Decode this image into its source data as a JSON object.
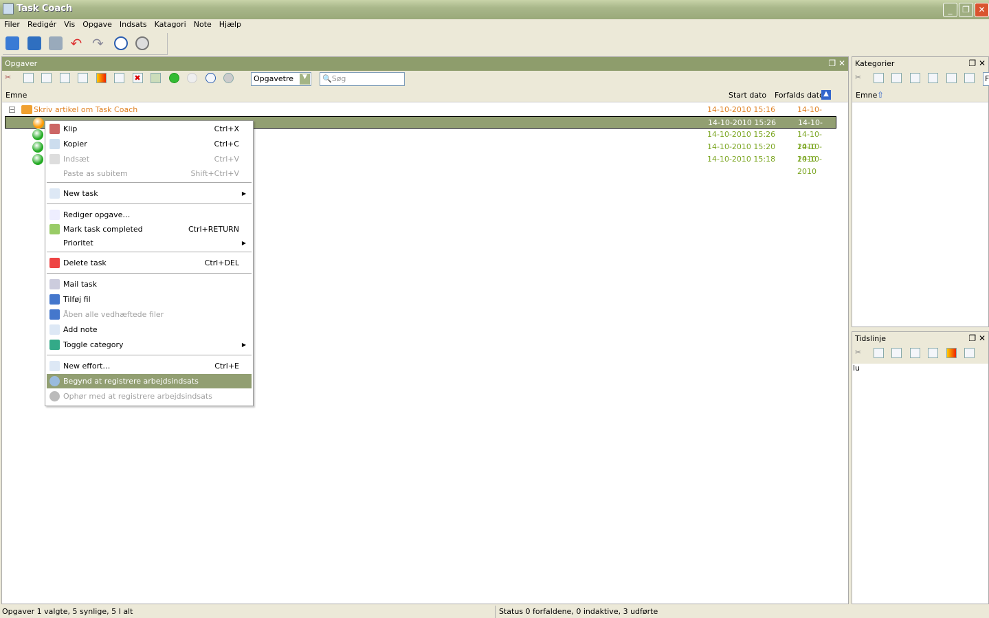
{
  "window": {
    "title": "Task Coach",
    "controls": [
      "minimize",
      "restore",
      "close"
    ]
  },
  "menubar": [
    "Filer",
    "Redigér",
    "Vis",
    "Opgave",
    "Indsats",
    "Katagori",
    "Note",
    "Hjælp"
  ],
  "main_toolbar": [
    "open-icon",
    "save-icon",
    "print-icon",
    "undo-icon",
    "redo-icon",
    "start-tracking-icon",
    "stop-tracking-icon"
  ],
  "tasks_panel": {
    "title": "Opgaver",
    "view_select": "Opgavetre",
    "search_placeholder": "Søg",
    "columns": {
      "subject": "Emne",
      "start": "Start dato",
      "due": "Forfalds dato"
    },
    "rows": [
      {
        "subject": "Skriv artikel om Task Coach",
        "start": "14-10-2010 15:16",
        "due": "14-10-2010",
        "status": "active",
        "color": "#e08020"
      },
      {
        "subject": "",
        "start": "14-10-2010 15:26",
        "due": "14-10-2010",
        "status": "selected",
        "color": "#ffffff"
      },
      {
        "subject": "",
        "start": "14-10-2010 15:26",
        "due": "14-10-2010",
        "status": "completed",
        "color": "#7aa51f"
      },
      {
        "subject": "",
        "start": "14-10-2010 15:20",
        "due": "14-10-2010",
        "status": "completed",
        "color": "#7aa51f"
      },
      {
        "subject": "",
        "start": "14-10-2010 15:18",
        "due": "14-10-2010",
        "status": "completed",
        "color": "#7aa51f"
      }
    ]
  },
  "context_menu": [
    {
      "label": "Klip",
      "shortcut": "Ctrl+X",
      "icon": "scissors-icon"
    },
    {
      "label": "Kopier",
      "shortcut": "Ctrl+C",
      "icon": "copy-icon"
    },
    {
      "label": "Indsæt",
      "shortcut": "Ctrl+V",
      "icon": "paste-icon",
      "disabled": true
    },
    {
      "label": "Paste as subitem",
      "shortcut": "Shift+Ctrl+V",
      "disabled": true
    },
    {
      "label": "New task",
      "submenu": true,
      "icon": "new-task-icon"
    },
    {
      "label": "Rediger opgave…",
      "icon": "edit-icon"
    },
    {
      "label": "Mark task completed",
      "shortcut": "Ctrl+RETURN",
      "icon": "checkmark-icon"
    },
    {
      "label": "Prioritet",
      "submenu": true
    },
    {
      "label": "Delete task",
      "shortcut": "Ctrl+DEL",
      "icon": "delete-icon"
    },
    {
      "label": "Mail task",
      "icon": "mail-icon"
    },
    {
      "label": "Tilføj fil",
      "icon": "paperclip-icon"
    },
    {
      "label": "Åben alle vedhæftede filer",
      "disabled": true,
      "icon": "paperclip-icon"
    },
    {
      "label": "Add note",
      "icon": "new-note-icon"
    },
    {
      "label": "Toggle category",
      "submenu": true,
      "icon": "category-icon"
    },
    {
      "label": "New effort…",
      "shortcut": "Ctrl+E",
      "icon": "new-effort-icon"
    },
    {
      "label": "Begynd at registrere arbejdsindsats",
      "highlighted": true,
      "icon": "clock-icon"
    },
    {
      "label": "Ophør med at registrere arbejdsindsats",
      "disabled": true,
      "icon": "stop-clock-icon"
    }
  ],
  "categories_panel": {
    "title": "Kategorier",
    "column": "Emne",
    "filter_text": "F"
  },
  "timeline_panel": {
    "title": "Tidslinje",
    "content": "lu"
  },
  "status": {
    "left": "Opgaver 1 valgte, 5 synlige, 5 I alt",
    "right": "Status 0 forfaldene, 0 indaktive, 3 udførte"
  },
  "colors": {
    "selection": "#929f72",
    "panel_header": "#8e9d6c",
    "completed": "#7aa51f",
    "active": "#e08020"
  }
}
